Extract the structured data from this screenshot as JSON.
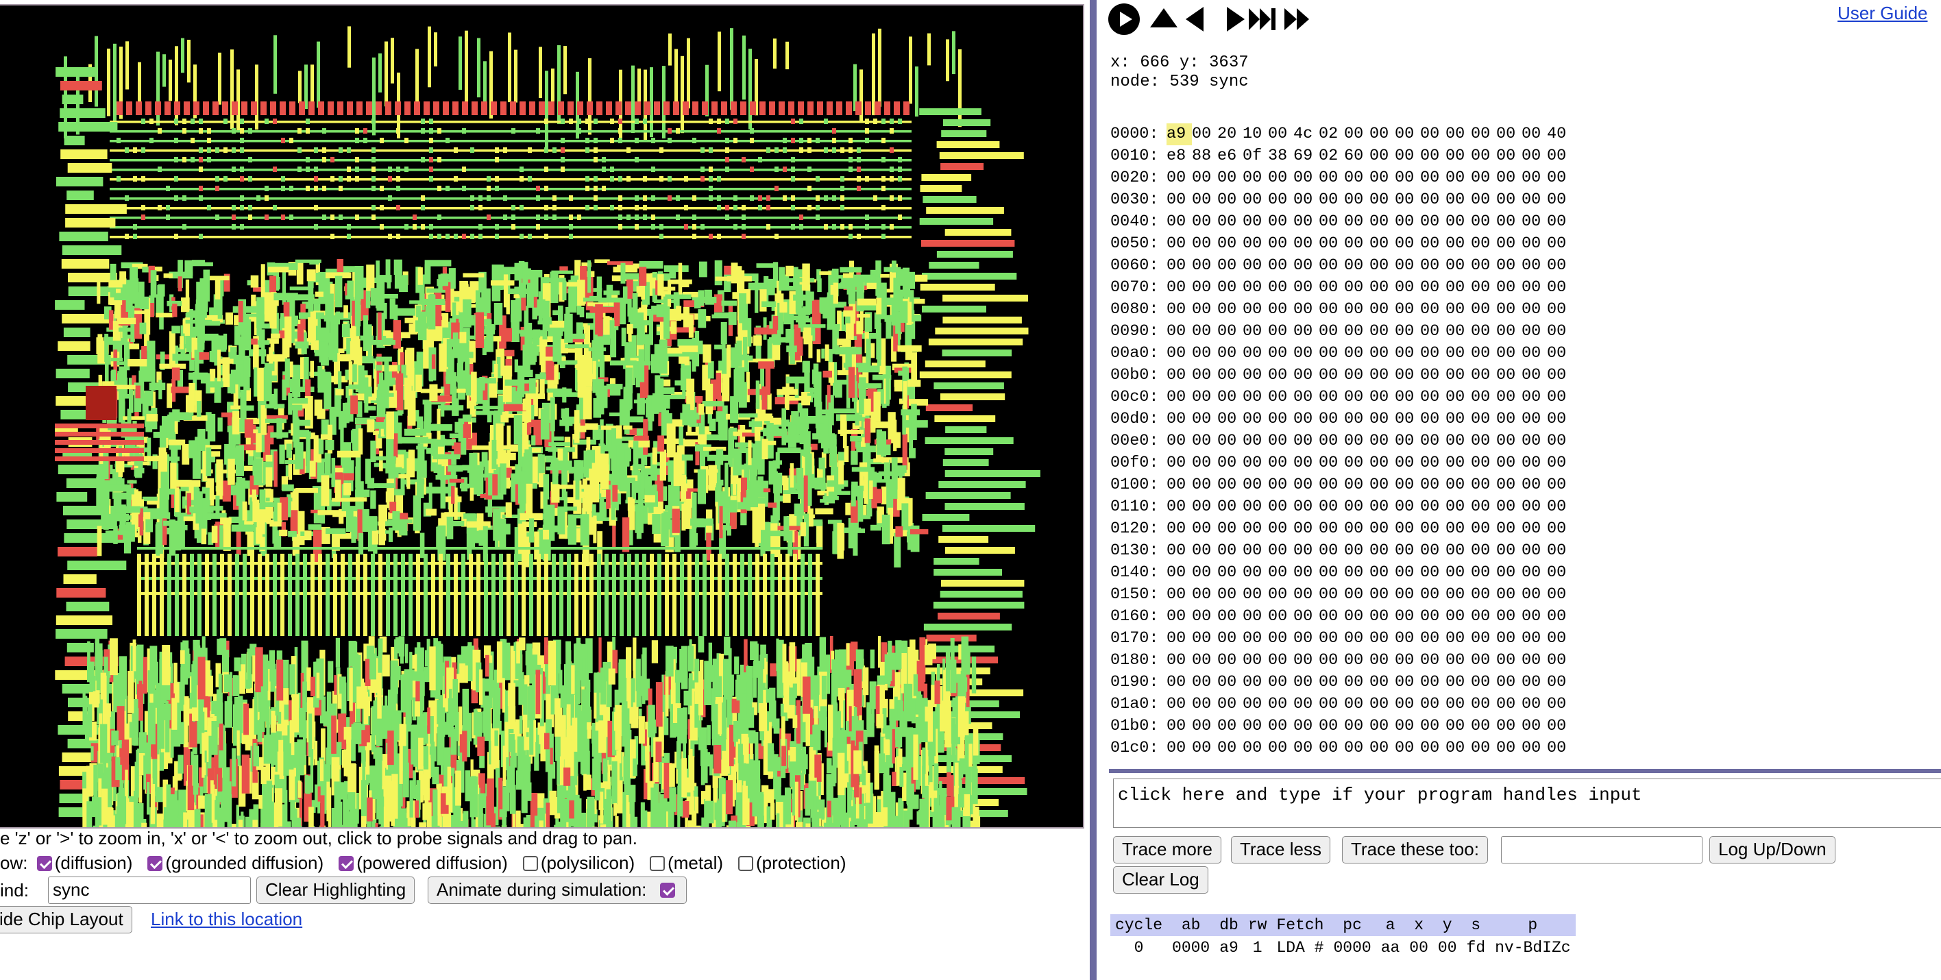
{
  "left": {
    "help_text": "e 'z' or '>' to zoom in, 'x' or '<' to zoom out, click to probe signals and drag to pan.",
    "show_label": "ow:",
    "layers": [
      {
        "label": "(diffusion)",
        "checked": true
      },
      {
        "label": "(grounded diffusion)",
        "checked": true
      },
      {
        "label": "(powered diffusion)",
        "checked": true
      },
      {
        "label": "(polysilicon)",
        "checked": false
      },
      {
        "label": "(metal)",
        "checked": false
      },
      {
        "label": "(protection)",
        "checked": false
      }
    ],
    "find_label": "ind:",
    "find_value": "sync",
    "clear_highlighting": "Clear Highlighting",
    "animate_label": "Animate during simulation:",
    "animate_checked": true,
    "hide_layout": "ide Chip Layout",
    "link_location": "Link to this location"
  },
  "colors": {
    "diffusion": "#7de36a",
    "grounded": "#f5f55c",
    "powered": "#e8524a",
    "accent": "#8b3fa8",
    "divider": "#6b6aa0"
  },
  "right": {
    "user_guide": "User Guide",
    "playback_icons": [
      "play-icon",
      "step-up-icon",
      "step-back-icon",
      "step-forward-icon",
      "fast-forward-end-icon",
      "fast-forward-icon"
    ],
    "coords": "x: 666 y: 3637",
    "node": "node: 539 sync",
    "memory": [
      {
        "addr": "0000:",
        "bytes": [
          "a9",
          "00",
          "20",
          "10",
          "00",
          "4c",
          "02",
          "00",
          "00",
          "00",
          "00",
          "00",
          "00",
          "00",
          "00",
          "40"
        ]
      },
      {
        "addr": "0010:",
        "bytes": [
          "e8",
          "88",
          "e6",
          "0f",
          "38",
          "69",
          "02",
          "60",
          "00",
          "00",
          "00",
          "00",
          "00",
          "00",
          "00",
          "00"
        ]
      },
      {
        "addr": "0020:",
        "bytes": [
          "00",
          "00",
          "00",
          "00",
          "00",
          "00",
          "00",
          "00",
          "00",
          "00",
          "00",
          "00",
          "00",
          "00",
          "00",
          "00"
        ]
      },
      {
        "addr": "0030:",
        "bytes": [
          "00",
          "00",
          "00",
          "00",
          "00",
          "00",
          "00",
          "00",
          "00",
          "00",
          "00",
          "00",
          "00",
          "00",
          "00",
          "00"
        ]
      },
      {
        "addr": "0040:",
        "bytes": [
          "00",
          "00",
          "00",
          "00",
          "00",
          "00",
          "00",
          "00",
          "00",
          "00",
          "00",
          "00",
          "00",
          "00",
          "00",
          "00"
        ]
      },
      {
        "addr": "0050:",
        "bytes": [
          "00",
          "00",
          "00",
          "00",
          "00",
          "00",
          "00",
          "00",
          "00",
          "00",
          "00",
          "00",
          "00",
          "00",
          "00",
          "00"
        ]
      },
      {
        "addr": "0060:",
        "bytes": [
          "00",
          "00",
          "00",
          "00",
          "00",
          "00",
          "00",
          "00",
          "00",
          "00",
          "00",
          "00",
          "00",
          "00",
          "00",
          "00"
        ]
      },
      {
        "addr": "0070:",
        "bytes": [
          "00",
          "00",
          "00",
          "00",
          "00",
          "00",
          "00",
          "00",
          "00",
          "00",
          "00",
          "00",
          "00",
          "00",
          "00",
          "00"
        ]
      },
      {
        "addr": "0080:",
        "bytes": [
          "00",
          "00",
          "00",
          "00",
          "00",
          "00",
          "00",
          "00",
          "00",
          "00",
          "00",
          "00",
          "00",
          "00",
          "00",
          "00"
        ]
      },
      {
        "addr": "0090:",
        "bytes": [
          "00",
          "00",
          "00",
          "00",
          "00",
          "00",
          "00",
          "00",
          "00",
          "00",
          "00",
          "00",
          "00",
          "00",
          "00",
          "00"
        ]
      },
      {
        "addr": "00a0:",
        "bytes": [
          "00",
          "00",
          "00",
          "00",
          "00",
          "00",
          "00",
          "00",
          "00",
          "00",
          "00",
          "00",
          "00",
          "00",
          "00",
          "00"
        ]
      },
      {
        "addr": "00b0:",
        "bytes": [
          "00",
          "00",
          "00",
          "00",
          "00",
          "00",
          "00",
          "00",
          "00",
          "00",
          "00",
          "00",
          "00",
          "00",
          "00",
          "00"
        ]
      },
      {
        "addr": "00c0:",
        "bytes": [
          "00",
          "00",
          "00",
          "00",
          "00",
          "00",
          "00",
          "00",
          "00",
          "00",
          "00",
          "00",
          "00",
          "00",
          "00",
          "00"
        ]
      },
      {
        "addr": "00d0:",
        "bytes": [
          "00",
          "00",
          "00",
          "00",
          "00",
          "00",
          "00",
          "00",
          "00",
          "00",
          "00",
          "00",
          "00",
          "00",
          "00",
          "00"
        ]
      },
      {
        "addr": "00e0:",
        "bytes": [
          "00",
          "00",
          "00",
          "00",
          "00",
          "00",
          "00",
          "00",
          "00",
          "00",
          "00",
          "00",
          "00",
          "00",
          "00",
          "00"
        ]
      },
      {
        "addr": "00f0:",
        "bytes": [
          "00",
          "00",
          "00",
          "00",
          "00",
          "00",
          "00",
          "00",
          "00",
          "00",
          "00",
          "00",
          "00",
          "00",
          "00",
          "00"
        ]
      },
      {
        "addr": "0100:",
        "bytes": [
          "00",
          "00",
          "00",
          "00",
          "00",
          "00",
          "00",
          "00",
          "00",
          "00",
          "00",
          "00",
          "00",
          "00",
          "00",
          "00"
        ]
      },
      {
        "addr": "0110:",
        "bytes": [
          "00",
          "00",
          "00",
          "00",
          "00",
          "00",
          "00",
          "00",
          "00",
          "00",
          "00",
          "00",
          "00",
          "00",
          "00",
          "00"
        ]
      },
      {
        "addr": "0120:",
        "bytes": [
          "00",
          "00",
          "00",
          "00",
          "00",
          "00",
          "00",
          "00",
          "00",
          "00",
          "00",
          "00",
          "00",
          "00",
          "00",
          "00"
        ]
      },
      {
        "addr": "0130:",
        "bytes": [
          "00",
          "00",
          "00",
          "00",
          "00",
          "00",
          "00",
          "00",
          "00",
          "00",
          "00",
          "00",
          "00",
          "00",
          "00",
          "00"
        ]
      },
      {
        "addr": "0140:",
        "bytes": [
          "00",
          "00",
          "00",
          "00",
          "00",
          "00",
          "00",
          "00",
          "00",
          "00",
          "00",
          "00",
          "00",
          "00",
          "00",
          "00"
        ]
      },
      {
        "addr": "0150:",
        "bytes": [
          "00",
          "00",
          "00",
          "00",
          "00",
          "00",
          "00",
          "00",
          "00",
          "00",
          "00",
          "00",
          "00",
          "00",
          "00",
          "00"
        ]
      },
      {
        "addr": "0160:",
        "bytes": [
          "00",
          "00",
          "00",
          "00",
          "00",
          "00",
          "00",
          "00",
          "00",
          "00",
          "00",
          "00",
          "00",
          "00",
          "00",
          "00"
        ]
      },
      {
        "addr": "0170:",
        "bytes": [
          "00",
          "00",
          "00",
          "00",
          "00",
          "00",
          "00",
          "00",
          "00",
          "00",
          "00",
          "00",
          "00",
          "00",
          "00",
          "00"
        ]
      },
      {
        "addr": "0180:",
        "bytes": [
          "00",
          "00",
          "00",
          "00",
          "00",
          "00",
          "00",
          "00",
          "00",
          "00",
          "00",
          "00",
          "00",
          "00",
          "00",
          "00"
        ]
      },
      {
        "addr": "0190:",
        "bytes": [
          "00",
          "00",
          "00",
          "00",
          "00",
          "00",
          "00",
          "00",
          "00",
          "00",
          "00",
          "00",
          "00",
          "00",
          "00",
          "00"
        ]
      },
      {
        "addr": "01a0:",
        "bytes": [
          "00",
          "00",
          "00",
          "00",
          "00",
          "00",
          "00",
          "00",
          "00",
          "00",
          "00",
          "00",
          "00",
          "00",
          "00",
          "00"
        ]
      },
      {
        "addr": "01b0:",
        "bytes": [
          "00",
          "00",
          "00",
          "00",
          "00",
          "00",
          "00",
          "00",
          "00",
          "00",
          "00",
          "00",
          "00",
          "00",
          "00",
          "00"
        ]
      },
      {
        "addr": "01c0:",
        "bytes": [
          "00",
          "00",
          "00",
          "00",
          "00",
          "00",
          "00",
          "00",
          "00",
          "00",
          "00",
          "00",
          "00",
          "00",
          "00",
          "00"
        ]
      }
    ],
    "console_text": "click here and type if your program handles input",
    "trace_more": "Trace more",
    "trace_less": "Trace less",
    "trace_these": "Trace these too:",
    "trace_value": "",
    "log_updown": "Log Up/Down",
    "clear_log": "Clear Log",
    "status_headers": [
      "cycle",
      "ab",
      "db",
      "rw",
      "Fetch",
      "pc",
      "a",
      "x",
      "y",
      "s",
      "p"
    ],
    "status_row": [
      "0",
      "0000",
      "a9",
      "1",
      "LDA #",
      "0000",
      "aa",
      "00",
      "00",
      "fd",
      "nv-BdIZc"
    ]
  }
}
